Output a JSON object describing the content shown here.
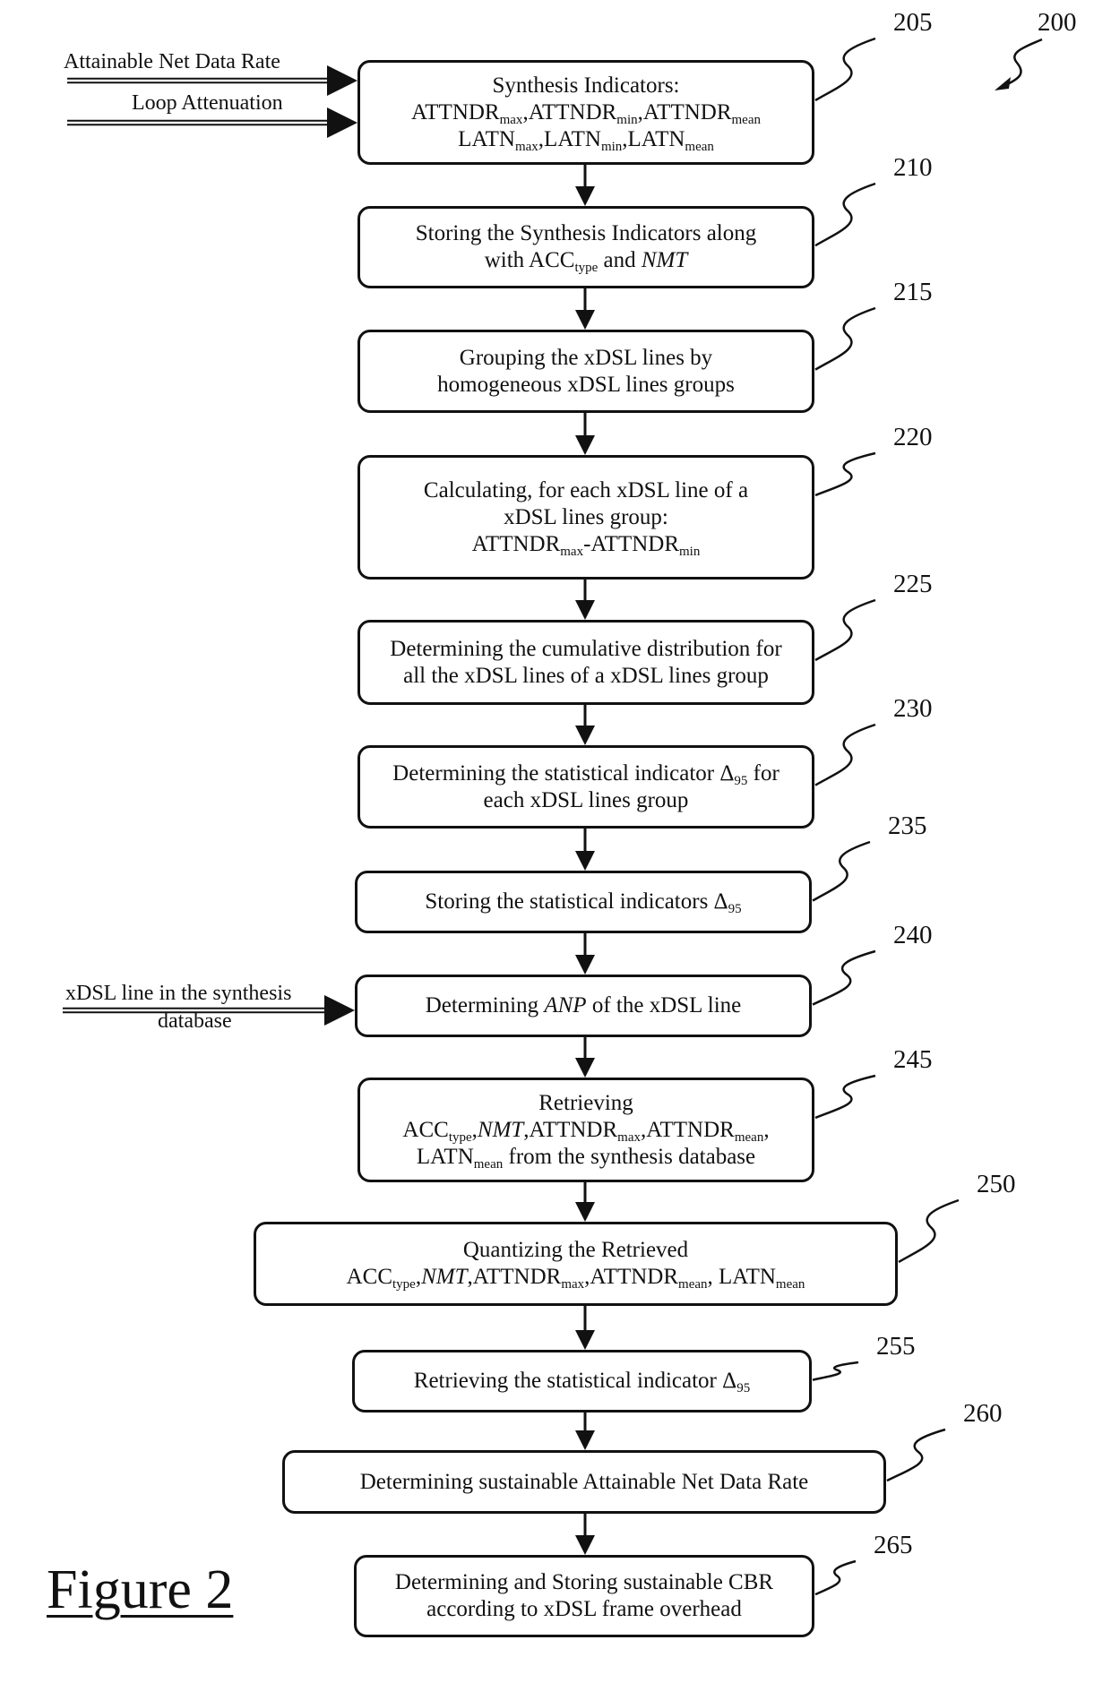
{
  "figure": {
    "label": "Figure 2",
    "ref": "200"
  },
  "inputs": [
    {
      "id": "attainable-net-data-rate",
      "lines": [
        "Attainable Net Data Rate"
      ],
      "target": "205"
    },
    {
      "id": "loop-attenuation",
      "lines": [
        "Loop Attenuation"
      ],
      "target": "205"
    },
    {
      "id": "xdsl-line-in-synthesis-database",
      "lines": [
        "xDSL line in the synthesis",
        "database"
      ],
      "target": "240"
    }
  ],
  "steps": [
    {
      "ref": "205",
      "lines": [
        [
          {
            "t": "Synthesis Indicators:"
          }
        ],
        [
          {
            "t": "ATTNDR"
          },
          {
            "sub": "max"
          },
          {
            "t": ",ATTNDR"
          },
          {
            "sub": "min"
          },
          {
            "t": ",ATTNDR"
          },
          {
            "sub": "mean"
          }
        ],
        [
          {
            "t": "LATN"
          },
          {
            "sub": "max"
          },
          {
            "t": ",LATN"
          },
          {
            "sub": "min"
          },
          {
            "t": ",LATN"
          },
          {
            "sub": "mean"
          }
        ]
      ]
    },
    {
      "ref": "210",
      "lines": [
        [
          {
            "t": "Storing the Synthesis Indicators along"
          }
        ],
        [
          {
            "t": "with ACC"
          },
          {
            "sub": "type"
          },
          {
            "t": " and "
          },
          {
            "i": "NMT"
          }
        ]
      ]
    },
    {
      "ref": "215",
      "lines": [
        [
          {
            "t": "Grouping the xDSL lines by"
          }
        ],
        [
          {
            "t": "homogeneous xDSL lines groups"
          }
        ]
      ]
    },
    {
      "ref": "220",
      "lines": [
        [
          {
            "t": "Calculating, for each xDSL line of a"
          }
        ],
        [
          {
            "t": "xDSL lines group:"
          }
        ],
        [
          {
            "t": "ATTNDR"
          },
          {
            "sub": "max"
          },
          {
            "t": "-ATTNDR"
          },
          {
            "sub": "min"
          }
        ]
      ]
    },
    {
      "ref": "225",
      "lines": [
        [
          {
            "t": "Determining the cumulative distribution for"
          }
        ],
        [
          {
            "t": "all the xDSL lines of a xDSL lines group"
          }
        ]
      ]
    },
    {
      "ref": "230",
      "lines": [
        [
          {
            "t": "Determining the statistical indicator Δ"
          },
          {
            "sub": "95"
          },
          {
            "t": " for"
          }
        ],
        [
          {
            "t": "each xDSL lines group"
          }
        ]
      ]
    },
    {
      "ref": "235",
      "lines": [
        [
          {
            "t": "Storing the statistical indicators Δ"
          },
          {
            "sub": "95"
          }
        ]
      ]
    },
    {
      "ref": "240",
      "lines": [
        [
          {
            "t": "Determining "
          },
          {
            "i": "ANP"
          },
          {
            "t": " of the xDSL line"
          }
        ]
      ]
    },
    {
      "ref": "245",
      "lines": [
        [
          {
            "t": "Retrieving"
          }
        ],
        [
          {
            "t": "ACC"
          },
          {
            "sub": "type"
          },
          {
            "t": ","
          },
          {
            "i": "NMT"
          },
          {
            "t": ",ATTNDR"
          },
          {
            "sub": "max"
          },
          {
            "t": ",ATTNDR"
          },
          {
            "sub": "mean"
          },
          {
            "t": ","
          }
        ],
        [
          {
            "t": "LATN"
          },
          {
            "sub": "mean"
          },
          {
            "t": " from the synthesis database"
          }
        ]
      ]
    },
    {
      "ref": "250",
      "lines": [
        [
          {
            "t": "Quantizing the Retrieved"
          }
        ],
        [
          {
            "t": "ACC"
          },
          {
            "sub": "type"
          },
          {
            "t": ","
          },
          {
            "i": "NMT"
          },
          {
            "t": ",ATTNDR"
          },
          {
            "sub": "max"
          },
          {
            "t": ",ATTNDR"
          },
          {
            "sub": "mean"
          },
          {
            "t": ", LATN"
          },
          {
            "sub": "mean"
          }
        ]
      ]
    },
    {
      "ref": "255",
      "lines": [
        [
          {
            "t": "Retrieving the statistical indicator Δ"
          },
          {
            "sub": "95"
          }
        ]
      ]
    },
    {
      "ref": "260",
      "lines": [
        [
          {
            "t": "Determining sustainable Attainable Net Data Rate"
          }
        ]
      ]
    },
    {
      "ref": "265",
      "lines": [
        [
          {
            "t": "Determining and Storing sustainable CBR"
          }
        ],
        [
          {
            "t": "according to xDSL frame overhead"
          }
        ]
      ]
    }
  ]
}
